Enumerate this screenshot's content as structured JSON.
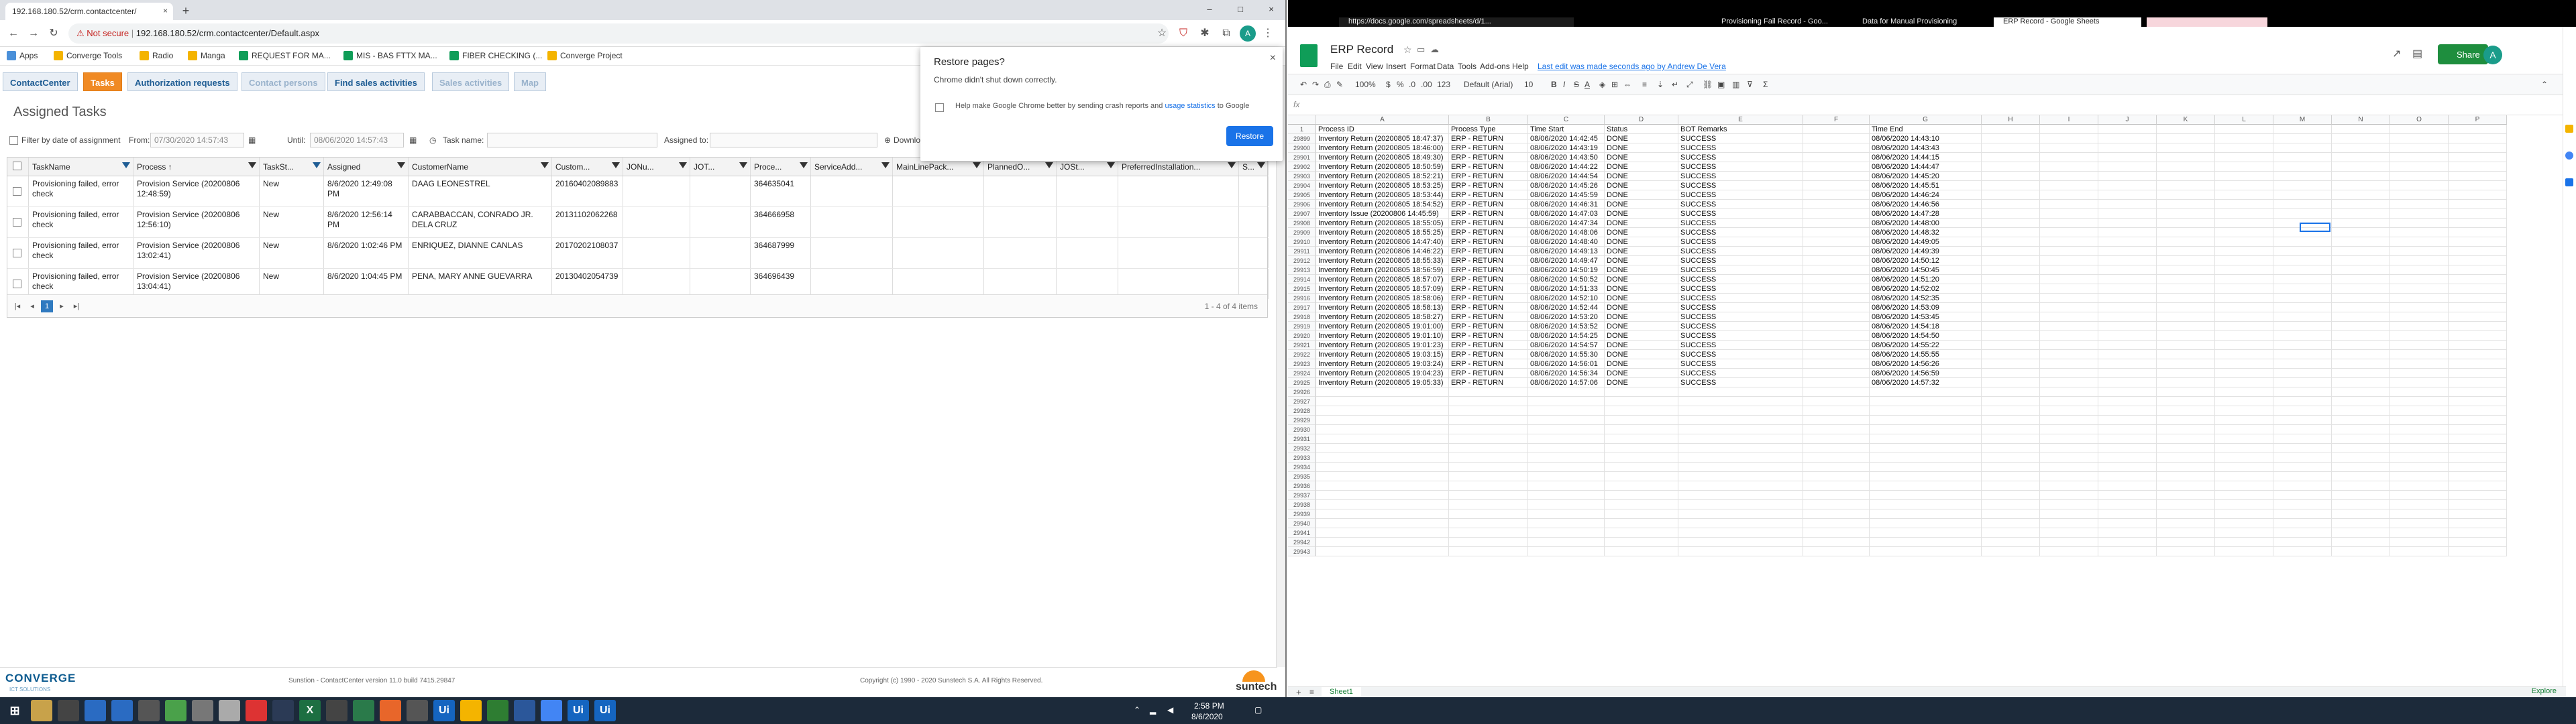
{
  "left_browser": {
    "tabs": [
      {
        "title": "192.168.180.52/crm.contactcenter/",
        "close": "×"
      }
    ],
    "new_tab": "+",
    "window_controls": [
      "–",
      "□",
      "×"
    ],
    "address": {
      "security": "Not secure",
      "url": "192.168.180.52/crm.contactcenter/Default.aspx"
    },
    "bookmarks": [
      {
        "label": "Apps",
        "color": "#4a90d9"
      },
      {
        "label": "Converge Tools",
        "color": "#f4b400"
      },
      {
        "label": "Radio",
        "color": "#f4b400"
      },
      {
        "label": "Manga",
        "color": "#f4b400"
      },
      {
        "label": "REQUEST FOR MA...",
        "color": "#0f9d58"
      },
      {
        "label": "MIS - BAS FTTX MA...",
        "color": "#0f9d58"
      },
      {
        "label": "FIBER CHECKING (...",
        "color": "#0f9d58"
      },
      {
        "label": "Converge Project",
        "color": "#f4b400"
      }
    ],
    "restore_dialog": {
      "title": "Restore pages?",
      "subtitle": "Chrome didn't shut down correctly.",
      "checkbox_text_1": "Help make Google Chrome better by sending crash reports and",
      "checkbox_link": "usage statistics",
      "checkbox_text_2": "to Google",
      "button": "Restore",
      "close": "×"
    }
  },
  "crm": {
    "nav_tabs": [
      "ContactCenter",
      "Tasks",
      "Authorization requests",
      "Contact persons",
      "Find sales activities",
      "Sales activities",
      "Map"
    ],
    "page_title": "Assigned Tasks",
    "filter": {
      "filter_by_date": "Filter by date of assignment",
      "from_label": "From:",
      "from_value": "07/30/2020 14:57:43",
      "until_label": "Until:",
      "until_value": "08/06/2020 14:57:43",
      "task_name_label": "Task name:",
      "assigned_to_label": "Assigned to:",
      "download": "Downloa"
    },
    "columns": [
      "TaskName",
      "Process ↑",
      "TaskSt...",
      "Assigned",
      "CustomerName",
      "Custom...",
      "JONu...",
      "JOT...",
      "Proce...",
      "ServiceAdd...",
      "MainLinePack...",
      "PlannedO...",
      "JOSt...",
      "PreferredInstallation...",
      "S..."
    ],
    "rows": [
      {
        "task": "Provisioning failed, error check",
        "process": "Provision Service (20200806 12:48:59)",
        "status": "New",
        "assigned": "8/6/2020 12:49:08 PM",
        "customer": "DAAG LEONESTREL",
        "custom": "20160402089883",
        "proc": "364635041"
      },
      {
        "task": "Provisioning failed, error check",
        "process": "Provision Service (20200806 12:56:10)",
        "status": "New",
        "assigned": "8/6/2020 12:56:14 PM",
        "customer": "CARABBACCAN, CONRADO JR. DELA CRUZ",
        "custom": "20131102062268",
        "proc": "364666958"
      },
      {
        "task": "Provisioning failed, error check",
        "process": "Provision Service (20200806 13:02:41)",
        "status": "New",
        "assigned": "8/6/2020 1:02:46 PM",
        "customer": "ENRIQUEZ, DIANNE CANLAS",
        "custom": "20170202108037",
        "proc": "364687999"
      },
      {
        "task": "Provisioning failed, error check",
        "process": "Provision Service (20200806 13:04:41)",
        "status": "New",
        "assigned": "8/6/2020 1:04:45 PM",
        "customer": "PENA, MARY ANNE GUEVARRA",
        "custom": "20130402054739",
        "proc": "364696439"
      }
    ],
    "pager": {
      "first": "|◂",
      "prev": "◂",
      "page": "1",
      "next": "▸",
      "last": "▸|",
      "summary": "1 - 4 of 4 items"
    },
    "footer": {
      "logo": "CONVERGE",
      "logo_sub": "ICT SOLUTIONS",
      "version": "Sunstion - ContactCenter version 11.0 build 7415.29847",
      "copyright": "Copyright (c) 1990 - 2020 Sunstech S.A. All Rights Reserved.",
      "brand": "suntech"
    }
  },
  "right_browser": {
    "tabs": [
      {
        "title": "https://docs.google.com/spreadsheets/d/1...",
        "active": false
      },
      {
        "title": "Provisioning Fail Record - Goo...",
        "active": false
      },
      {
        "title": "Data for Manual Provisioning",
        "active": false
      },
      {
        "title": "ERP Record - Google Sheets",
        "active": true
      }
    ],
    "sheets": {
      "title": "ERP Record",
      "menu": [
        "File",
        "Edit",
        "View",
        "Insert",
        "Format",
        "Data",
        "Tools",
        "Add-ons",
        "Help"
      ],
      "last_edit": "Last edit was made seconds ago by Andrew De Vera",
      "share": "Share",
      "avatar": "A",
      "toolbar": {
        "zoom": "100%",
        "currency": "$",
        "percent": "%",
        "dec0": ".0",
        "dec00": ".00",
        "fmt": "123",
        "font": "Default (Arial)",
        "size": "10",
        "bold": "B",
        "italic": "I",
        "strike": "S",
        "textcolor": "A",
        "sum": "Σ"
      },
      "fx": "fx",
      "col_letters": [
        "A",
        "B",
        "C",
        "D",
        "E",
        "F",
        "G",
        "H",
        "I",
        "J",
        "K",
        "L",
        "M",
        "N",
        "O",
        "P"
      ],
      "header_row": {
        "num": "1",
        "cells": [
          "Process ID",
          "Process Type",
          "Time Start",
          "Status",
          "BOT Remarks",
          "",
          "Time End"
        ]
      },
      "rows": [
        {
          "n": "29899",
          "id": "Inventory Return (20200805 18:47:37)",
          "type": "ERP - RETURN",
          "start": "08/06/2020 14:42:45",
          "status": "DONE",
          "remarks": "SUCCESS",
          "end": "08/06/2020 14:43:10"
        },
        {
          "n": "29900",
          "id": "Inventory Return (20200805 18:46:00)",
          "type": "ERP - RETURN",
          "start": "08/06/2020 14:43:19",
          "status": "DONE",
          "remarks": "SUCCESS",
          "end": "08/06/2020 14:43:43"
        },
        {
          "n": "29901",
          "id": "Inventory Return (20200805 18:49:30)",
          "type": "ERP - RETURN",
          "start": "08/06/2020 14:43:50",
          "status": "DONE",
          "remarks": "SUCCESS",
          "end": "08/06/2020 14:44:15"
        },
        {
          "n": "29902",
          "id": "Inventory Return (20200805 18:50:59)",
          "type": "ERP - RETURN",
          "start": "08/06/2020 14:44:22",
          "status": "DONE",
          "remarks": "SUCCESS",
          "end": "08/06/2020 14:44:47"
        },
        {
          "n": "29903",
          "id": "Inventory Return (20200805 18:52:21)",
          "type": "ERP - RETURN",
          "start": "08/06/2020 14:44:54",
          "status": "DONE",
          "remarks": "SUCCESS",
          "end": "08/06/2020 14:45:20"
        },
        {
          "n": "29904",
          "id": "Inventory Return (20200805 18:53:25)",
          "type": "ERP - RETURN",
          "start": "08/06/2020 14:45:26",
          "status": "DONE",
          "remarks": "SUCCESS",
          "end": "08/06/2020 14:45:51"
        },
        {
          "n": "29905",
          "id": "Inventory Return (20200805 18:53:44)",
          "type": "ERP - RETURN",
          "start": "08/06/2020 14:45:59",
          "status": "DONE",
          "remarks": "SUCCESS",
          "end": "08/06/2020 14:46:24"
        },
        {
          "n": "29906",
          "id": "Inventory Return (20200805 18:54:52)",
          "type": "ERP - RETURN",
          "start": "08/06/2020 14:46:31",
          "status": "DONE",
          "remarks": "SUCCESS",
          "end": "08/06/2020 14:46:56"
        },
        {
          "n": "29907",
          "id": "Inventory Issue (20200806 14:45:59)",
          "type": "ERP - RETURN",
          "start": "08/06/2020 14:47:03",
          "status": "DONE",
          "remarks": "SUCCESS",
          "end": "08/06/2020 14:47:28"
        },
        {
          "n": "29908",
          "id": "Inventory Return (20200805 18:55:05)",
          "type": "ERP - RETURN",
          "start": "08/06/2020 14:47:34",
          "status": "DONE",
          "remarks": "SUCCESS",
          "end": "08/06/2020 14:48:00"
        },
        {
          "n": "29909",
          "id": "Inventory Return (20200805 18:55:25)",
          "type": "ERP - RETURN",
          "start": "08/06/2020 14:48:06",
          "status": "DONE",
          "remarks": "SUCCESS",
          "end": "08/06/2020 14:48:32"
        },
        {
          "n": "29910",
          "id": "Inventory Return (20200806 14:47:40)",
          "type": "ERP - RETURN",
          "start": "08/06/2020 14:48:40",
          "status": "DONE",
          "remarks": "SUCCESS",
          "end": "08/06/2020 14:49:05"
        },
        {
          "n": "29911",
          "id": "Inventory Return (20200806 14:46:22)",
          "type": "ERP - RETURN",
          "start": "08/06/2020 14:49:13",
          "status": "DONE",
          "remarks": "SUCCESS",
          "end": "08/06/2020 14:49:39"
        },
        {
          "n": "29912",
          "id": "Inventory Return (20200805 18:55:33)",
          "type": "ERP - RETURN",
          "start": "08/06/2020 14:49:47",
          "status": "DONE",
          "remarks": "SUCCESS",
          "end": "08/06/2020 14:50:12"
        },
        {
          "n": "29913",
          "id": "Inventory Return (20200805 18:56:59)",
          "type": "ERP - RETURN",
          "start": "08/06/2020 14:50:19",
          "status": "DONE",
          "remarks": "SUCCESS",
          "end": "08/06/2020 14:50:45"
        },
        {
          "n": "29914",
          "id": "Inventory Return (20200805 18:57:07)",
          "type": "ERP - RETURN",
          "start": "08/06/2020 14:50:52",
          "status": "DONE",
          "remarks": "SUCCESS",
          "end": "08/06/2020 14:51:20"
        },
        {
          "n": "29915",
          "id": "Inventory Return (20200805 18:57:09)",
          "type": "ERP - RETURN",
          "start": "08/06/2020 14:51:33",
          "status": "DONE",
          "remarks": "SUCCESS",
          "end": "08/06/2020 14:52:02"
        },
        {
          "n": "29916",
          "id": "Inventory Return (20200805 18:58:06)",
          "type": "ERP - RETURN",
          "start": "08/06/2020 14:52:10",
          "status": "DONE",
          "remarks": "SUCCESS",
          "end": "08/06/2020 14:52:35"
        },
        {
          "n": "29917",
          "id": "Inventory Return (20200805 18:58:13)",
          "type": "ERP - RETURN",
          "start": "08/06/2020 14:52:44",
          "status": "DONE",
          "remarks": "SUCCESS",
          "end": "08/06/2020 14:53:09"
        },
        {
          "n": "29918",
          "id": "Inventory Return (20200805 18:58:27)",
          "type": "ERP - RETURN",
          "start": "08/06/2020 14:53:20",
          "status": "DONE",
          "remarks": "SUCCESS",
          "end": "08/06/2020 14:53:45"
        },
        {
          "n": "29919",
          "id": "Inventory Return (20200805 19:01:00)",
          "type": "ERP - RETURN",
          "start": "08/06/2020 14:53:52",
          "status": "DONE",
          "remarks": "SUCCESS",
          "end": "08/06/2020 14:54:18"
        },
        {
          "n": "29920",
          "id": "Inventory Return (20200805 19:01:10)",
          "type": "ERP - RETURN",
          "start": "08/06/2020 14:54:25",
          "status": "DONE",
          "remarks": "SUCCESS",
          "end": "08/06/2020 14:54:50"
        },
        {
          "n": "29921",
          "id": "Inventory Return (20200805 19:01:23)",
          "type": "ERP - RETURN",
          "start": "08/06/2020 14:54:57",
          "status": "DONE",
          "remarks": "SUCCESS",
          "end": "08/06/2020 14:55:22"
        },
        {
          "n": "29922",
          "id": "Inventory Return (20200805 19:03:15)",
          "type": "ERP - RETURN",
          "start": "08/06/2020 14:55:30",
          "status": "DONE",
          "remarks": "SUCCESS",
          "end": "08/06/2020 14:55:55"
        },
        {
          "n": "29923",
          "id": "Inventory Return (20200805 19:03:24)",
          "type": "ERP - RETURN",
          "start": "08/06/2020 14:56:01",
          "status": "DONE",
          "remarks": "SUCCESS",
          "end": "08/06/2020 14:56:26"
        },
        {
          "n": "29924",
          "id": "Inventory Return (20200805 19:04:23)",
          "type": "ERP - RETURN",
          "start": "08/06/2020 14:56:34",
          "status": "DONE",
          "remarks": "SUCCESS",
          "end": "08/06/2020 14:56:59"
        },
        {
          "n": "29925",
          "id": "Inventory Return (20200805 19:05:33)",
          "type": "ERP - RETURN",
          "start": "08/06/2020 14:57:06",
          "status": "DONE",
          "remarks": "SUCCESS",
          "end": "08/06/2020 14:57:32"
        }
      ],
      "empty_rows": [
        "29926",
        "29927",
        "29928",
        "29929",
        "29930",
        "29931",
        "29932",
        "29933",
        "29934",
        "29935",
        "29936",
        "29937",
        "29938",
        "29939",
        "29940",
        "29941",
        "29942",
        "29943"
      ],
      "sheet_tab": "Sheet1",
      "explore": "Explore"
    }
  },
  "taskbar": {
    "time": "2:58 PM",
    "date": "8/6/2020"
  }
}
